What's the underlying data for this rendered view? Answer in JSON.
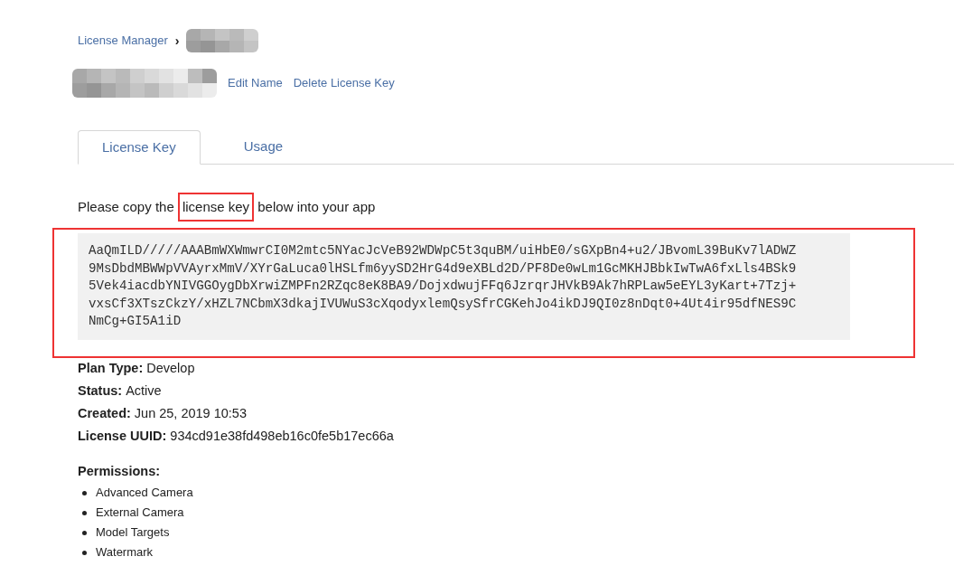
{
  "breadcrumb": {
    "link": "License Manager",
    "separator": "›"
  },
  "title_actions": [
    "Edit Name",
    "Delete License Key"
  ],
  "tabs": [
    {
      "label": "License Key",
      "selected": true
    },
    {
      "label": "Usage",
      "selected": false
    }
  ],
  "intro": {
    "before": "Please copy the ",
    "highlight": "license key",
    "after": " below into your app"
  },
  "license_key_lines": [
    "AaQmILD/////AAABmWXWmwrCI0M2mtc5NYacJcVeB92WDWpC5t3quBM/uiHbE0/sGXpBn4+u2/JBvomL39BuKv7lADWZ",
    "9MsDbdMBWWpVVAyrxMmV/XYrGaLuca0lHSLfm6yySD2HrG4d9eXBLd2D/PF8De0wLm1GcMKHJBbkIwTwA6fxLls4BSk9",
    "5Vek4iacdbYNIVGGOygDbXrwiZMPFn2RZqc8eK8BA9/DojxdwujFFq6JzrqrJHVkB9Ak7hRPLaw5eEYL3yKart+7Tzj+",
    "vxsCf3XTszCkzY/xHZL7NCbmX3dkajIVUWuS3cXqodyxlemQsySfrCGKehJo4ikDJ9QI0z8nDqt0+4Ut4ir95dfNES9C",
    "NmCg+GI5A1iD"
  ],
  "details": [
    {
      "label": "Plan Type:",
      "value": "Develop"
    },
    {
      "label": "Status:",
      "value": "Active"
    },
    {
      "label": "Created:",
      "value": "Jun 25, 2019 10:53"
    },
    {
      "label": "License UUID:",
      "value": "934cd91e38fd498eb16c0fe5b17ec66a"
    }
  ],
  "permissions": {
    "title": "Permissions:",
    "items": [
      "Advanced Camera",
      "External Camera",
      "Model Targets",
      "Watermark"
    ]
  }
}
